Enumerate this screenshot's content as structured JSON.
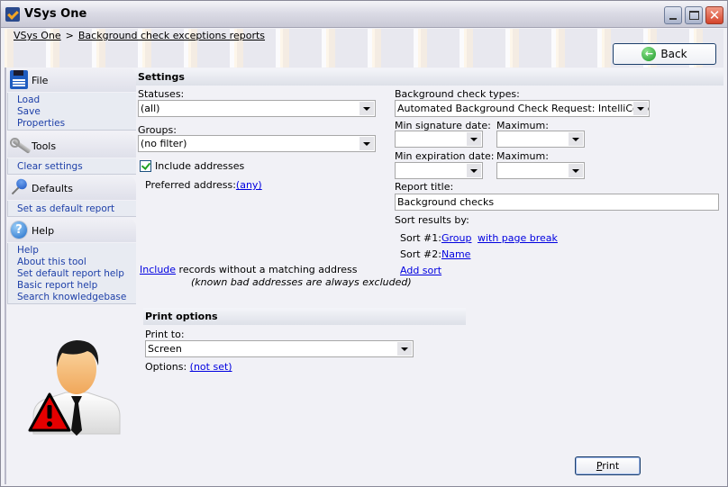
{
  "window": {
    "title": "VSys One",
    "controls": {
      "minimize": "minimize",
      "maximize": "maximize",
      "close": "✕"
    }
  },
  "breadcrumb": {
    "items": [
      "VSys One",
      "Background check exceptions reports"
    ],
    "separator": ">"
  },
  "header": {
    "back_label": "Back",
    "back_icon": "←"
  },
  "sidebar": {
    "sections": [
      {
        "title": "File",
        "icon": "floppy-disk-icon",
        "items": [
          "Load",
          "Save",
          "Properties"
        ]
      },
      {
        "title": "Tools",
        "icon": "wrench-icon",
        "items": [
          "Clear settings"
        ]
      },
      {
        "title": "Defaults",
        "icon": "pushpin-icon",
        "items": [
          "Set as default report"
        ]
      },
      {
        "title": "Help",
        "icon": "help-icon",
        "icon_glyph": "?",
        "items": [
          "Help",
          "About this tool",
          "Set default report help",
          "Basic report help",
          "Search knowledgebase"
        ]
      }
    ],
    "illustration": "user-warning-icon"
  },
  "settings": {
    "title": "Settings",
    "statuses": {
      "label": "Statuses:",
      "value": "(all)"
    },
    "groups": {
      "label": "Groups:",
      "value": "(no filter)"
    },
    "include_addresses": {
      "label": "Include addresses",
      "checked": true
    },
    "preferred_address": {
      "label": "Preferred address:",
      "value": "(any)"
    },
    "include_records": {
      "link": "Include",
      "text": " records without a matching address",
      "note": "(known bad addresses are always excluded)"
    },
    "check_types": {
      "label": "Background check types:",
      "value": "Automated Background Check Request: IntelliCorp"
    },
    "min_signature": {
      "label": "Min signature date:",
      "value": ""
    },
    "max_signature": {
      "label": "Maximum:",
      "value": ""
    },
    "min_expiration": {
      "label": "Min expiration date:",
      "value": ""
    },
    "max_expiration": {
      "label": "Maximum:",
      "value": ""
    },
    "report_title": {
      "label": "Report title:",
      "value": "Background checks"
    },
    "sort": {
      "label": "Sort results by:",
      "sorts": [
        {
          "prefix": "Sort #1:",
          "field": "Group",
          "extra": "with page break"
        },
        {
          "prefix": "Sort #2:",
          "field": "Name"
        }
      ],
      "add_label": "Add sort"
    }
  },
  "print_options": {
    "title": "Print options",
    "print_to": {
      "label": "Print to:",
      "value": "Screen"
    },
    "options": {
      "label": "Options: ",
      "value": "(not set)"
    },
    "print_button": {
      "underlined": "P",
      "rest": "rint"
    }
  }
}
